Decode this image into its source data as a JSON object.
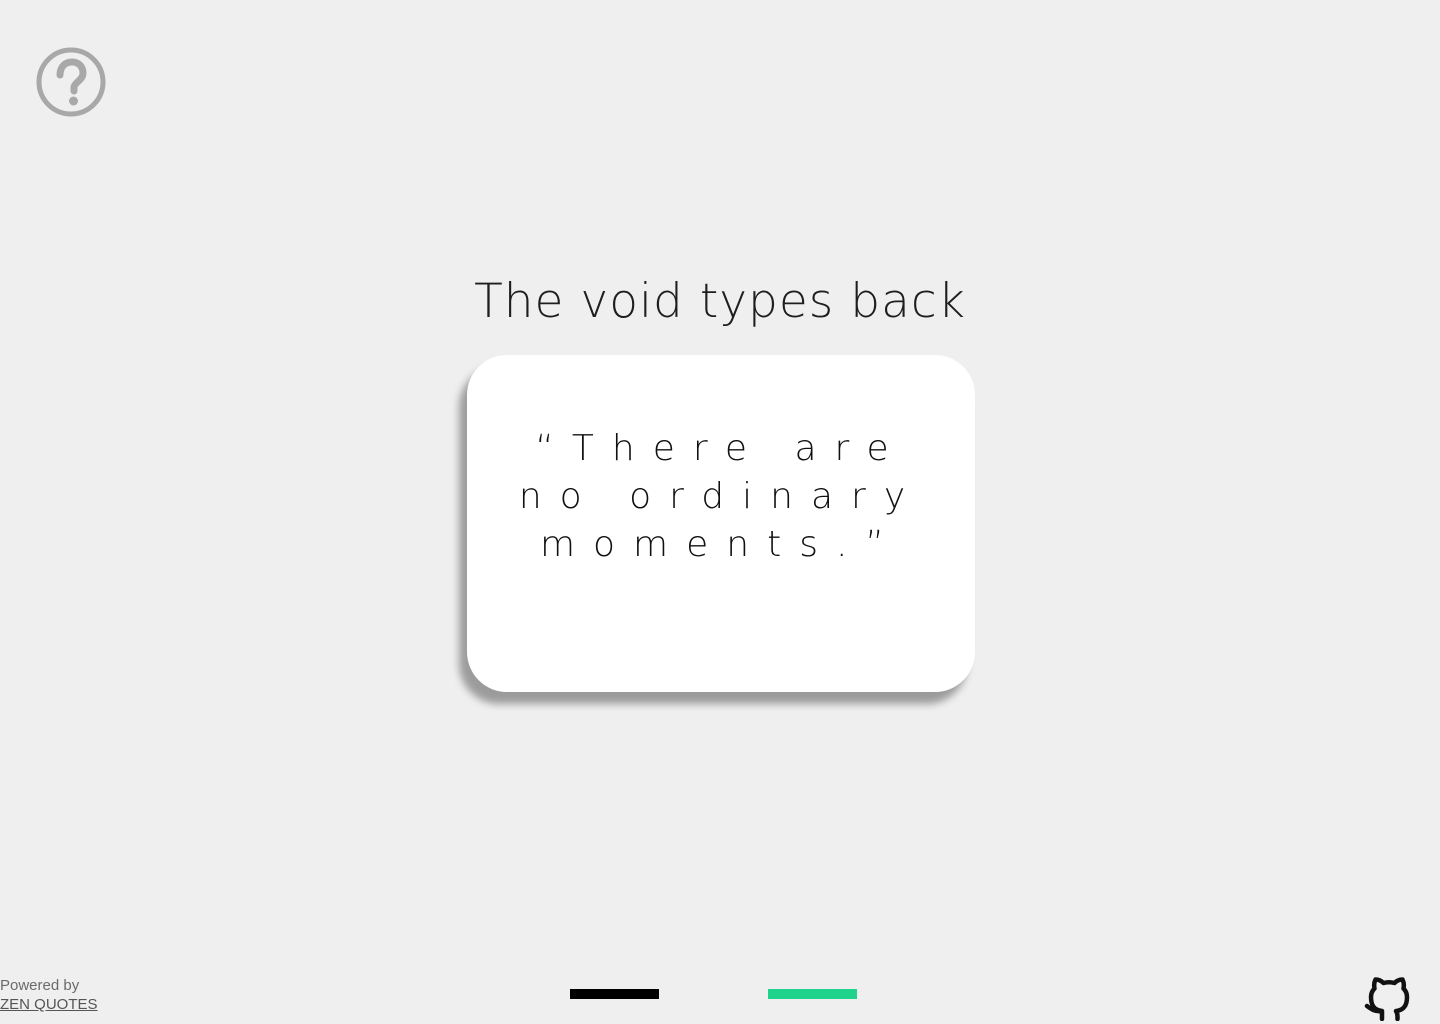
{
  "header": {
    "title": "The void types back"
  },
  "quote": {
    "text": "“There are no ordinary moments.”"
  },
  "footer": {
    "powered_label": "Powered by",
    "provider_link": "ZEN QUOTES"
  },
  "indicators": [
    {
      "color": "#000000"
    },
    {
      "color": "#1fd38c"
    }
  ],
  "icons": {
    "help": "question-circle-icon",
    "github": "github-icon"
  },
  "colors": {
    "background": "#efefef",
    "card": "#ffffff",
    "accent": "#1fd38c",
    "icon_gray": "#a8a8a8"
  }
}
